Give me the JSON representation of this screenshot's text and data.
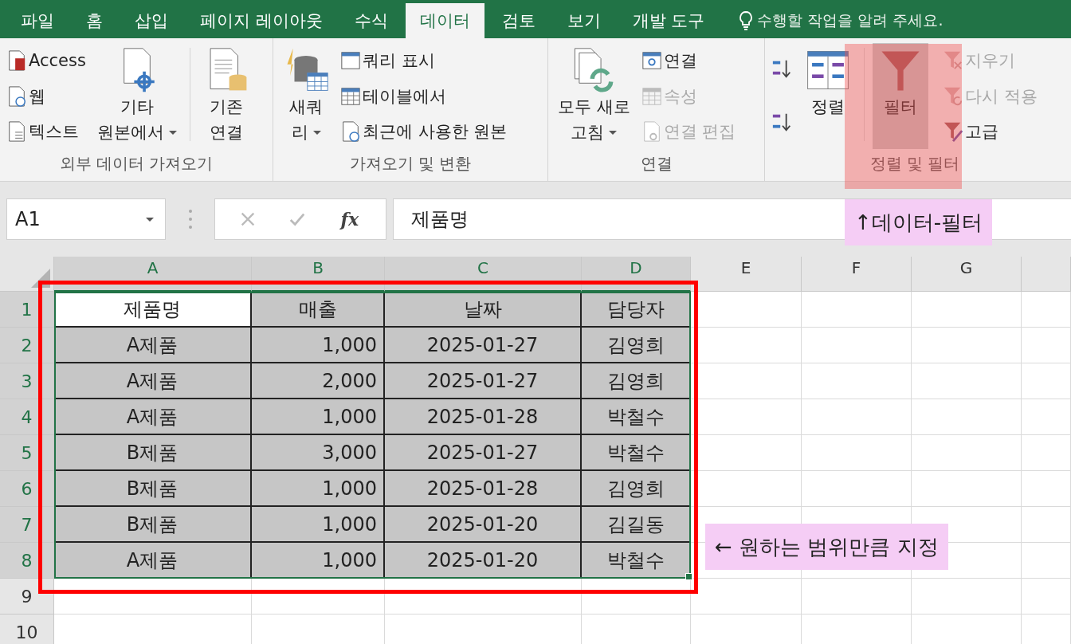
{
  "tabs": [
    {
      "label": "파일",
      "selected": false
    },
    {
      "label": "홈",
      "selected": false
    },
    {
      "label": "삽입",
      "selected": false
    },
    {
      "label": "페이지 레이아웃",
      "selected": false
    },
    {
      "label": "수식",
      "selected": false
    },
    {
      "label": "데이터",
      "selected": true
    },
    {
      "label": "검토",
      "selected": false
    },
    {
      "label": "보기",
      "selected": false
    },
    {
      "label": "개발 도구",
      "selected": false
    }
  ],
  "tell_me": "수행할 작업을 알려 주세요.",
  "ribbon_groups": [
    {
      "label": "외부 데이터 가져오기",
      "items": [
        {
          "kind": "stack",
          "buttons": [
            {
              "label": "Access",
              "disabled": false
            },
            {
              "label": "웹",
              "disabled": false
            },
            {
              "label": "텍스트",
              "disabled": false
            }
          ]
        },
        {
          "kind": "large",
          "lines": [
            "기타",
            "원본에서"
          ],
          "dropdown": true,
          "selected": false
        },
        {
          "kind": "separator"
        },
        {
          "kind": "large",
          "lines": [
            "기존",
            "연결"
          ],
          "dropdown": false,
          "selected": false
        }
      ]
    },
    {
      "label": "가져오기 및 변환",
      "items": [
        {
          "kind": "large",
          "lines": [
            "새쿼",
            "리"
          ],
          "dropdown": true,
          "selected": false
        },
        {
          "kind": "stack",
          "buttons": [
            {
              "label": "쿼리 표시",
              "disabled": false
            },
            {
              "label": "테이블에서",
              "disabled": false
            },
            {
              "label": "최근에 사용한 원본",
              "disabled": false
            }
          ]
        }
      ]
    },
    {
      "label": "연결",
      "items": [
        {
          "kind": "large",
          "lines": [
            "모두 새로",
            "고침"
          ],
          "dropdown": true,
          "selected": false
        },
        {
          "kind": "stack",
          "buttons": [
            {
              "label": "연결",
              "disabled": false
            },
            {
              "label": "속성",
              "disabled": true
            },
            {
              "label": "연결 편집",
              "disabled": true
            }
          ]
        }
      ]
    },
    {
      "label": "정렬 및 필터",
      "items": [
        {
          "kind": "iconstack"
        },
        {
          "kind": "large",
          "lines": [
            "정렬"
          ],
          "dropdown": false,
          "selected": false
        },
        {
          "kind": "separator"
        },
        {
          "kind": "large",
          "lines": [
            "필터"
          ],
          "dropdown": false,
          "selected": true
        },
        {
          "kind": "stack",
          "buttons": [
            {
              "label": "지우기",
              "disabled": true
            },
            {
              "label": "다시 적용",
              "disabled": true
            },
            {
              "label": "고급",
              "disabled": false
            }
          ]
        }
      ]
    }
  ],
  "formula_bar": {
    "name_box": "A1",
    "function_button": "fx",
    "formula": "제품명"
  },
  "grid": {
    "columns": [
      {
        "letter": "A",
        "selected": true
      },
      {
        "letter": "B",
        "selected": true
      },
      {
        "letter": "C",
        "selected": true
      },
      {
        "letter": "D",
        "selected": true
      },
      {
        "letter": "E",
        "selected": false
      },
      {
        "letter": "F",
        "selected": false
      },
      {
        "letter": "G",
        "selected": false
      }
    ],
    "rows": [
      {
        "number": "1",
        "selected": true,
        "kind": "header",
        "active_cell": true,
        "cells": [
          "제품명",
          "매출",
          "날짜",
          "담당자"
        ]
      },
      {
        "number": "2",
        "selected": true,
        "kind": "data",
        "active_cell": false,
        "cells": [
          "A제품",
          "1,000",
          "2025-01-27",
          "김영희"
        ]
      },
      {
        "number": "3",
        "selected": true,
        "kind": "data",
        "active_cell": false,
        "cells": [
          "A제품",
          "2,000",
          "2025-01-27",
          "김영희"
        ]
      },
      {
        "number": "4",
        "selected": true,
        "kind": "data",
        "active_cell": false,
        "cells": [
          "A제품",
          "1,000",
          "2025-01-28",
          "박철수"
        ]
      },
      {
        "number": "5",
        "selected": true,
        "kind": "data",
        "active_cell": false,
        "cells": [
          "B제품",
          "3,000",
          "2025-01-27",
          "박철수"
        ]
      },
      {
        "number": "6",
        "selected": true,
        "kind": "data",
        "active_cell": false,
        "cells": [
          "B제품",
          "1,000",
          "2025-01-28",
          "김영희"
        ]
      },
      {
        "number": "7",
        "selected": true,
        "kind": "data",
        "active_cell": false,
        "cells": [
          "B제품",
          "1,000",
          "2025-01-20",
          "김길동"
        ]
      },
      {
        "number": "8",
        "selected": true,
        "kind": "data",
        "active_cell": false,
        "cells": [
          "A제품",
          "1,000",
          "2025-01-20",
          "박철수"
        ]
      },
      {
        "number": "9",
        "selected": false,
        "kind": "empty"
      },
      {
        "number": "10",
        "selected": false,
        "kind": "empty"
      }
    ]
  },
  "annotations": [
    {
      "kind": "note-up",
      "text": "↑데이터-필터"
    },
    {
      "kind": "note-left",
      "text": "← 원하는 범위만큼 지정"
    }
  ]
}
